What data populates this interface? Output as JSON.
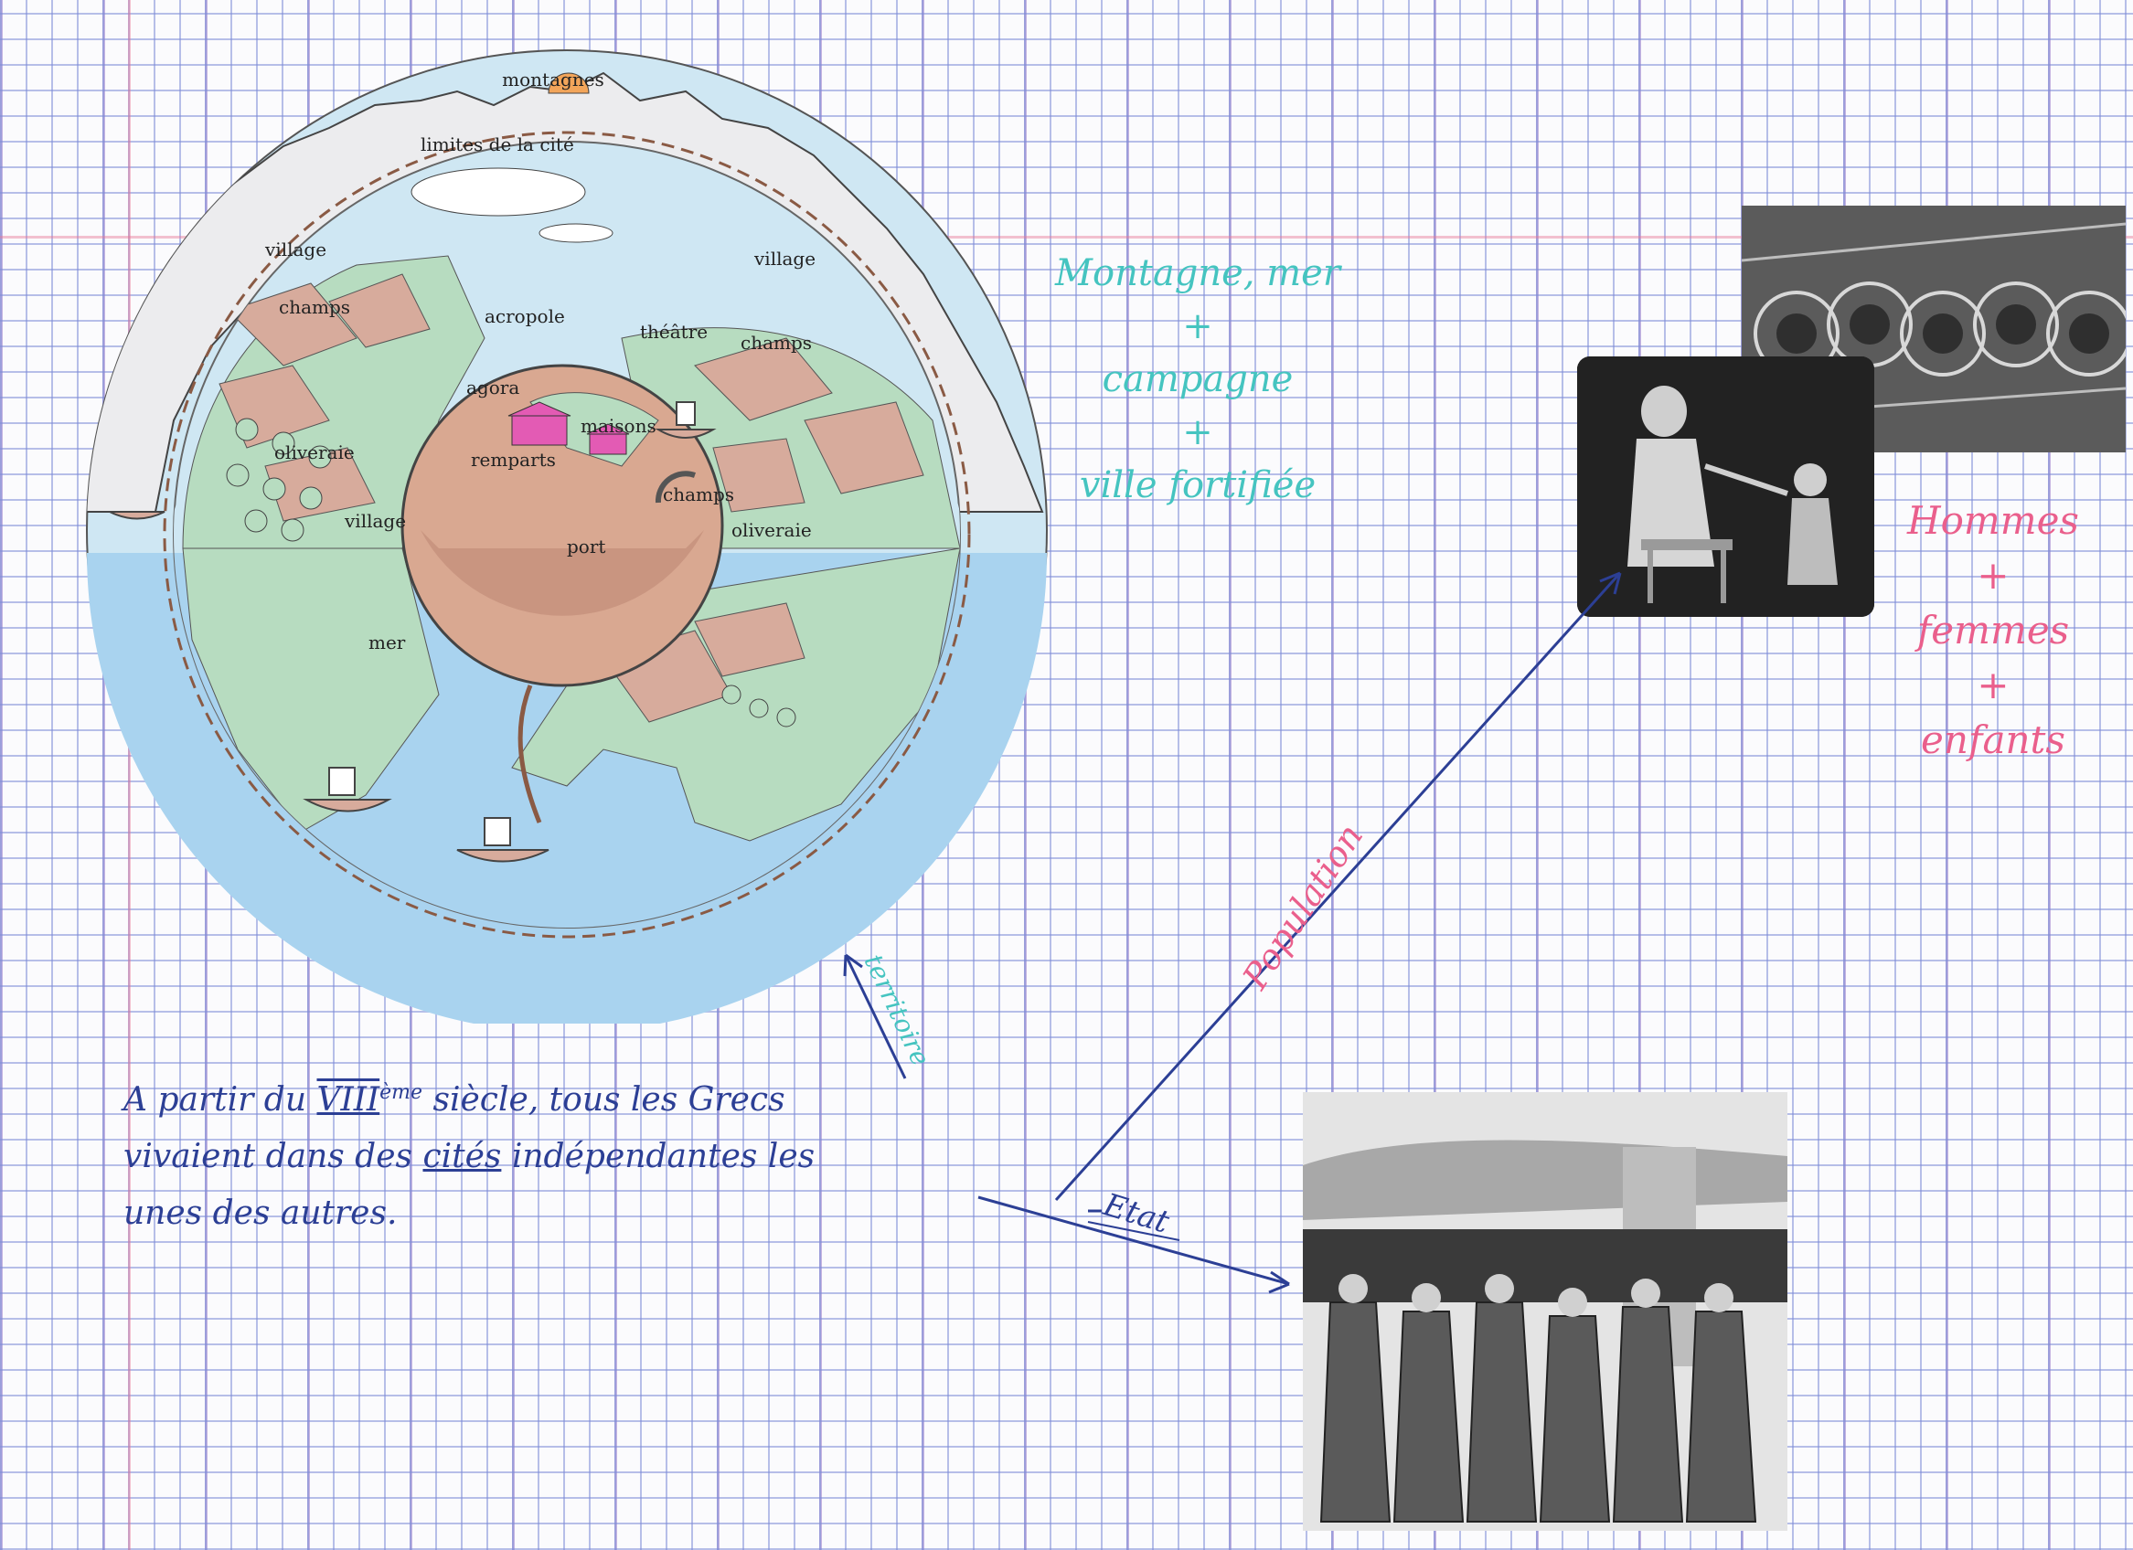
{
  "map": {
    "labels": {
      "montagnes": "montagnes",
      "limites": "limites de la cité",
      "village_left": "village",
      "village_right": "village",
      "village_bottom": "village",
      "champs_left": "champs",
      "champs_right": "champs",
      "champs_bottom": "champs",
      "acropole": "acropole",
      "theatre": "théâtre",
      "agora": "agora",
      "maisons": "maisons",
      "remparts": "remparts",
      "oliveraie_left": "oliveraie",
      "oliveraie_right": "oliveraie",
      "port": "port",
      "mer": "mer"
    }
  },
  "notes": {
    "geography": {
      "line1": "Montagne, mer",
      "plus1": "+",
      "line2": "campagne",
      "plus2": "+",
      "line3": "ville fortifiée"
    },
    "population": {
      "line1": "Hommes",
      "plus1": "+",
      "line2": "femmes",
      "plus2": "+",
      "line3": "enfants"
    },
    "arrow_territoire": "territoire",
    "arrow_population": "Population",
    "arrow_etat": "Etat"
  },
  "text_block": {
    "line1_a": "A partir du",
    "line1_century": "VIII",
    "line1_sup": "ème",
    "line1_b": "siècle, tous les Grecs",
    "line2_a": "vivaient dans des",
    "line2_cites": "cités",
    "line2_b": "indépendantes les",
    "line3": "unes des autres."
  },
  "colors": {
    "sea": "#a9d3ef",
    "land_green": "#b7dcc0",
    "fields_brown": "#d7ab9c",
    "mountain_gray": "#e8e8ea",
    "ink_teal": "#45c4c0",
    "ink_pink": "#ea5f8c",
    "ink_blue": "#2c3f95"
  }
}
